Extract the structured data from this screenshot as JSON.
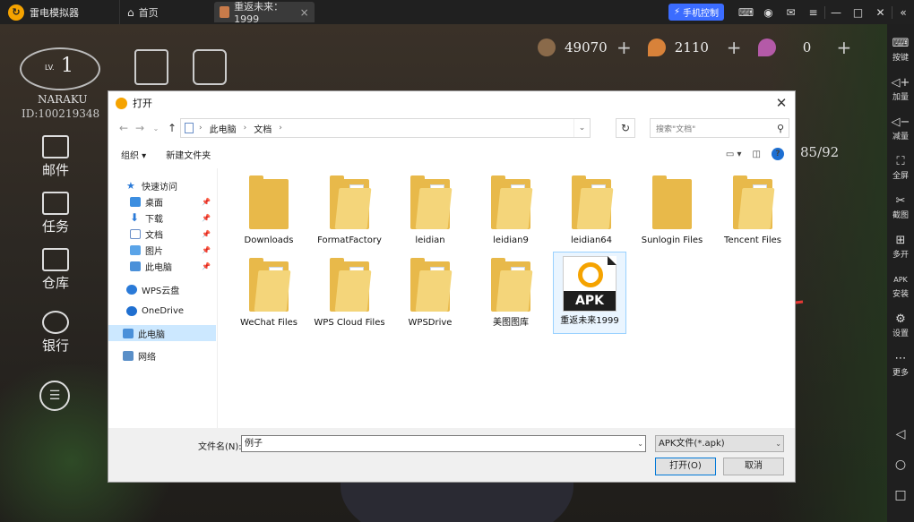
{
  "emulator": {
    "app_name": "雷电模拟器",
    "home_tab": "首页",
    "game_tab": "重返未来：1999",
    "phone_control": "手机控制"
  },
  "game": {
    "level_prefix": "LV.",
    "level": "1",
    "player_name": "NARAKU",
    "player_id": "ID:100219348",
    "resources": [
      "49070",
      "2110",
      "0"
    ],
    "stamina": "85/92",
    "menu": [
      "邮件",
      "任务",
      "仓库",
      "银行"
    ]
  },
  "sidebar": {
    "items": [
      "按键",
      "加量",
      "减量",
      "全屏",
      "截图",
      "多开",
      "安装",
      "设置",
      "更多"
    ],
    "apk_badge": "APK"
  },
  "dialog": {
    "title": "打开",
    "breadcrumb": [
      "此电脑",
      "文档"
    ],
    "search_placeholder": "搜索\"文档\"",
    "organize": "组织 ▾",
    "new_folder": "新建文件夹",
    "nav": [
      {
        "label": "快速访问"
      },
      {
        "label": "桌面"
      },
      {
        "label": "下载"
      },
      {
        "label": "文档"
      },
      {
        "label": "图片"
      },
      {
        "label": "此电脑"
      },
      {
        "label": "WPS云盘"
      },
      {
        "label": "OneDrive"
      },
      {
        "label": "此电脑"
      },
      {
        "label": "网络"
      }
    ],
    "files": [
      "Downloads",
      "FormatFactory",
      "leidian",
      "leidian9",
      "leidian64",
      "Sunlogin Files",
      "Tencent Files",
      "WeChat Files",
      "WPS Cloud Files",
      "WPSDrive",
      "美图图库",
      "重返未来1999"
    ],
    "apk_label": "APK",
    "filename_label": "文件名(N):",
    "filename_value": "例子",
    "filetype": "APK文件(*.apk)",
    "open_button": "打开(O)",
    "cancel_button": "取消"
  },
  "colors": {
    "accent": "#f5a300",
    "phone_button": "#3b6cff",
    "selection": "#cce8ff",
    "arrow": "#e53935"
  }
}
